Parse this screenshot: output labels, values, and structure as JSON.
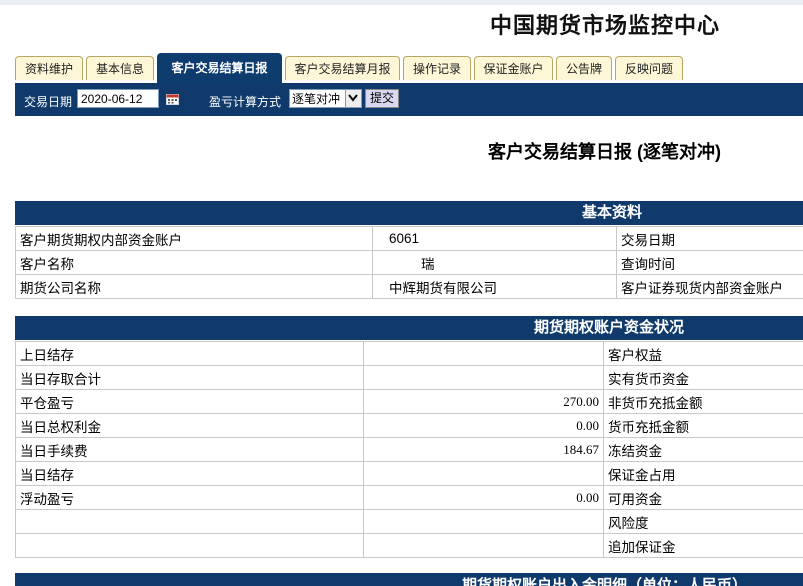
{
  "header": {
    "title": "中国期货市场监控中心"
  },
  "tabs": [
    {
      "label": "资料维护"
    },
    {
      "label": "基本信息"
    },
    {
      "label": "客户交易结算日报"
    },
    {
      "label": "客户交易结算月报"
    },
    {
      "label": "操作记录"
    },
    {
      "label": "保证金账户"
    },
    {
      "label": "公告牌"
    },
    {
      "label": "反映问题"
    }
  ],
  "toolbar": {
    "date_label": "交易日期",
    "date_value": "2020-06-12",
    "method_label": "盈亏计算方式",
    "method_value": "逐笔对冲",
    "submit_label": "提交"
  },
  "report": {
    "title": "客户交易结算日报 (逐笔对冲)"
  },
  "basic_info": {
    "header": "基本资料",
    "rows": [
      {
        "label": "客户期货期权内部资金账户",
        "value": "6061",
        "right_label": "交易日期"
      },
      {
        "label": "客户名称",
        "value": "瑞",
        "right_label": "查询时间"
      },
      {
        "label": "期货公司名称",
        "value": "中辉期货有限公司",
        "right_label": "客户证券现货内部资金账户"
      }
    ]
  },
  "funds": {
    "header": "期货期权账户资金状况",
    "rows": [
      {
        "label": "上日结存",
        "value": "",
        "right_label": "客户权益"
      },
      {
        "label": "当日存取合计",
        "value": "",
        "right_label": "实有货币资金"
      },
      {
        "label": "平仓盈亏",
        "value": "270.00",
        "right_label": "非货币充抵金额"
      },
      {
        "label": "当日总权利金",
        "value": "0.00",
        "right_label": "货币充抵金额"
      },
      {
        "label": "当日手续费",
        "value": "184.67",
        "right_label": "冻结资金"
      },
      {
        "label": "当日结存",
        "value": "",
        "right_label": "保证金占用"
      },
      {
        "label": "浮动盈亏",
        "value": "0.00",
        "right_label": "可用资金"
      },
      {
        "label": "",
        "value": "",
        "right_label": "风险度"
      },
      {
        "label": "",
        "value": "",
        "right_label": "追加保证金"
      }
    ]
  },
  "footer": {
    "header_partial": "期货期权账户出入金明细（单位：人民币）"
  },
  "icons": {
    "calendar": "calendar-icon",
    "dropdown": "chevron-down-icon"
  },
  "colors": {
    "primary": "#0f3a6b",
    "tab_bg": "#fdf7d7",
    "submit_bg": "#d8d8f0"
  }
}
